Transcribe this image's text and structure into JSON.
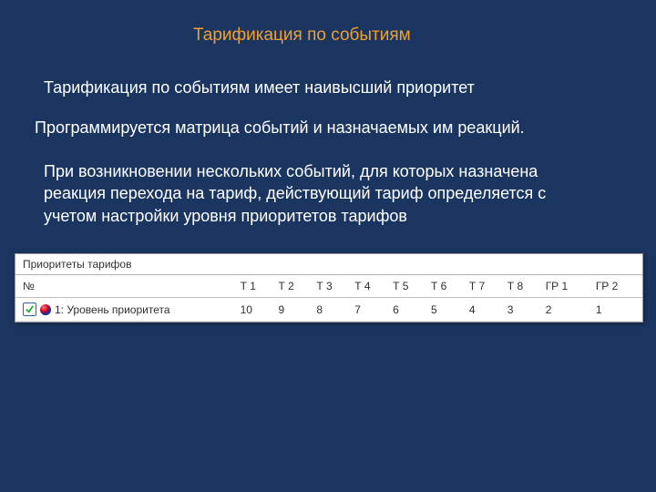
{
  "title": "Тарификация по событиям",
  "paragraphs": {
    "p1": "Тарификация по событиям имеет наивысший приоритет",
    "p2": "Программируется матрица событий и назначаемых им реакций.",
    "p3": "При возникновении нескольких событий, для которых назначена реакция перехода на тариф, действующий тариф определяется с учетом настройки уровня приоритетов тарифов"
  },
  "panel": {
    "title": "Приоритеты тарифов",
    "columns": {
      "no": "№",
      "t1": "Т 1",
      "t2": "Т 2",
      "t3": "Т 3",
      "t4": "Т 4",
      "t5": "Т 5",
      "t6": "Т 6",
      "t7": "Т 7",
      "t8": "Т 8",
      "gp1": "ГР 1",
      "gp2": "ГР 2"
    },
    "row": {
      "checked": true,
      "label": "1: Уровень приоритета",
      "t1": "10",
      "t2": "9",
      "t3": "8",
      "t4": "7",
      "t5": "6",
      "t6": "5",
      "t7": "4",
      "t8": "3",
      "gp1": "2",
      "gp2": "1"
    }
  }
}
